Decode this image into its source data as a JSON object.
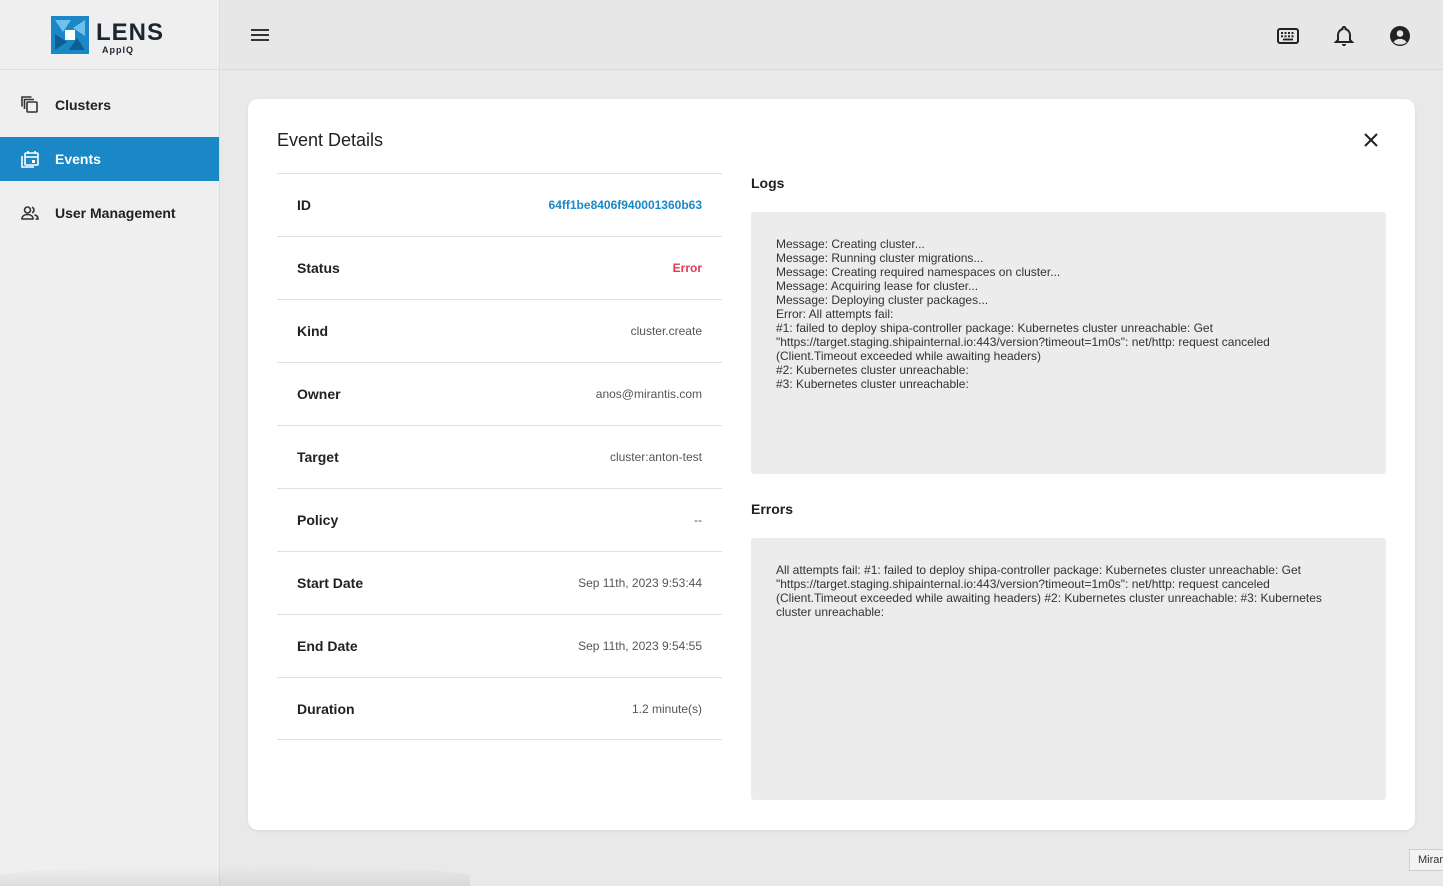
{
  "brand": {
    "name": "LENS",
    "sub": "AppIQ",
    "logo_icon": "lens-aperture-logo",
    "accent": "#1a87c7"
  },
  "sidebar": {
    "items": [
      {
        "label": "Clusters",
        "icon": "stacked-layers-icon",
        "active": false
      },
      {
        "label": "Events",
        "icon": "calendar-icon",
        "active": true
      },
      {
        "label": "User Management",
        "icon": "users-icon",
        "active": false
      }
    ]
  },
  "topbar": {
    "menu_icon": "hamburger-icon",
    "icons": [
      "keyboard-icon",
      "bell-icon",
      "account-circle-icon"
    ]
  },
  "card": {
    "title": "Event Details",
    "details": [
      {
        "label": "ID",
        "value": "64ff1be8406f940001360b63"
      },
      {
        "label": "Status",
        "value": "Error"
      },
      {
        "label": "Kind",
        "value": "cluster.create"
      },
      {
        "label": "Owner",
        "value": "anos@mirantis.com"
      },
      {
        "label": "Target",
        "value": "cluster:anton-test"
      },
      {
        "label": "Policy",
        "value": "--"
      },
      {
        "label": "Start Date",
        "value": "Sep 11th, 2023 9:53:44"
      },
      {
        "label": "End Date",
        "value": "Sep 11th, 2023 9:54:55"
      },
      {
        "label": "Duration",
        "value": "1.2 minute(s)"
      }
    ],
    "logs_title": "Logs",
    "logs": "Message: Creating cluster...\nMessage: Running cluster migrations...\nMessage: Creating required namespaces on cluster...\nMessage: Acquiring lease for cluster...\nMessage: Deploying cluster packages...\nError: All attempts fail:\n#1: failed to deploy shipa-controller package: Kubernetes cluster unreachable: Get\n\"https://target.staging.shipainternal.io:443/version?timeout=1m0s\": net/http: request canceled\n(Client.Timeout exceeded while awaiting headers)\n#2: Kubernetes cluster unreachable:\n#3: Kubernetes cluster unreachable:",
    "errors_title": "Errors",
    "errors": "All attempts fail: #1: failed to deploy shipa-controller package: Kubernetes cluster unreachable: Get\n\"https://target.staging.shipainternal.io:443/version?timeout=1m0s\": net/http: request canceled\n(Client.Timeout exceeded while awaiting headers) #2: Kubernetes cluster unreachable: #3: Kubernetes\ncluster unreachable:"
  },
  "tooltip": "Mirar",
  "colors": {
    "status_error": "#e53950",
    "sidebar_active": "#1a87c7"
  }
}
